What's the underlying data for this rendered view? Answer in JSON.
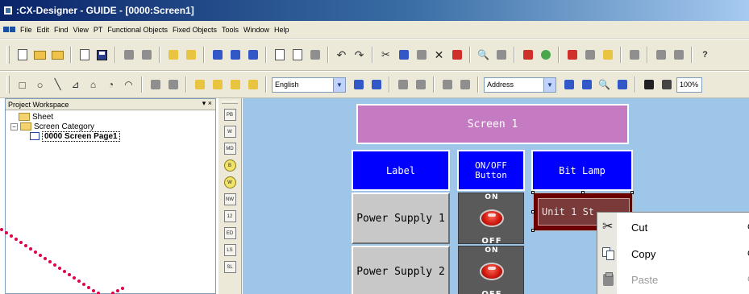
{
  "titlebar": {
    "title": ":CX-Designer - GUIDE - [0000:Screen1]"
  },
  "menubar": {
    "items": [
      "File",
      "Edit",
      "Find",
      "View",
      "PT",
      "Functional Objects",
      "Fixed Objects",
      "Tools",
      "Window",
      "Help"
    ]
  },
  "toolbar2": {
    "language_value": "English",
    "address_value": "Address",
    "zoom_value": "100%"
  },
  "workspace": {
    "title": "Project Workspace",
    "close_glyph": "▾ ×",
    "tree": {
      "sheet": "Sheet",
      "screen_category": "Screen Category",
      "page": "0000 Screen Page1",
      "expander": "−"
    }
  },
  "toolbox": {
    "items": [
      "PB",
      "W",
      "MD",
      "B",
      "W",
      "NW",
      "12",
      "ED",
      "LS",
      "SL"
    ]
  },
  "screen": {
    "title": "Screen 1",
    "headers": {
      "label": "Label",
      "onoff": "ON/OFF\nButton",
      "lamp": "Bit Lamp"
    },
    "labels": [
      "Power Supply 1",
      "Power Supply 2"
    ],
    "onoff_on": "ON",
    "onoff_off": "OFF",
    "lamp_text": "Unit 1 St"
  },
  "context_menu": {
    "items": [
      {
        "label": "Cut",
        "shortcut": "C",
        "enabled": true
      },
      {
        "label": "Copy",
        "shortcut": "C",
        "enabled": true
      },
      {
        "label": "Paste",
        "shortcut": "C",
        "enabled": false
      }
    ]
  },
  "colors": {
    "canvas_bg": "#9ec6e8",
    "screen_title_bg": "#c47bc2",
    "header_bg": "#0000ff",
    "lamp_bg": "#6b0000",
    "annotation_dots": "#e0004a"
  }
}
